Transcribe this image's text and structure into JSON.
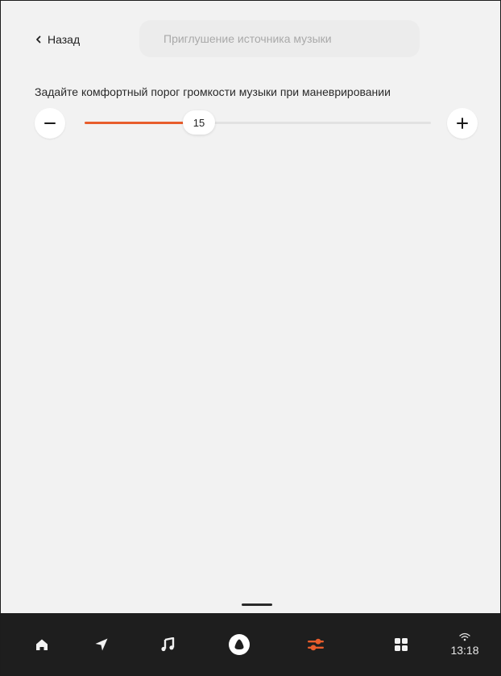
{
  "header": {
    "back_label": "Назад",
    "title": "Приглушение источника музыки"
  },
  "settings": {
    "description": "Задайте комфортный порог громкости музыки при маневрировании"
  },
  "slider": {
    "value": "15",
    "min": 0,
    "max": 100,
    "fill_fraction": 0.33,
    "accent_color": "#e85d2c"
  },
  "bottom_nav": {
    "items": [
      {
        "id": "home",
        "icon": "home-icon"
      },
      {
        "id": "navigation",
        "icon": "navigation-arrow-icon"
      },
      {
        "id": "music",
        "icon": "music-note-icon"
      },
      {
        "id": "alice",
        "icon": "alice-assistant-icon"
      },
      {
        "id": "settings",
        "icon": "sliders-icon",
        "active": true
      },
      {
        "id": "apps",
        "icon": "apps-grid-icon"
      }
    ],
    "status": {
      "time": "13:18",
      "signal_icon": "wifi-icon"
    }
  }
}
